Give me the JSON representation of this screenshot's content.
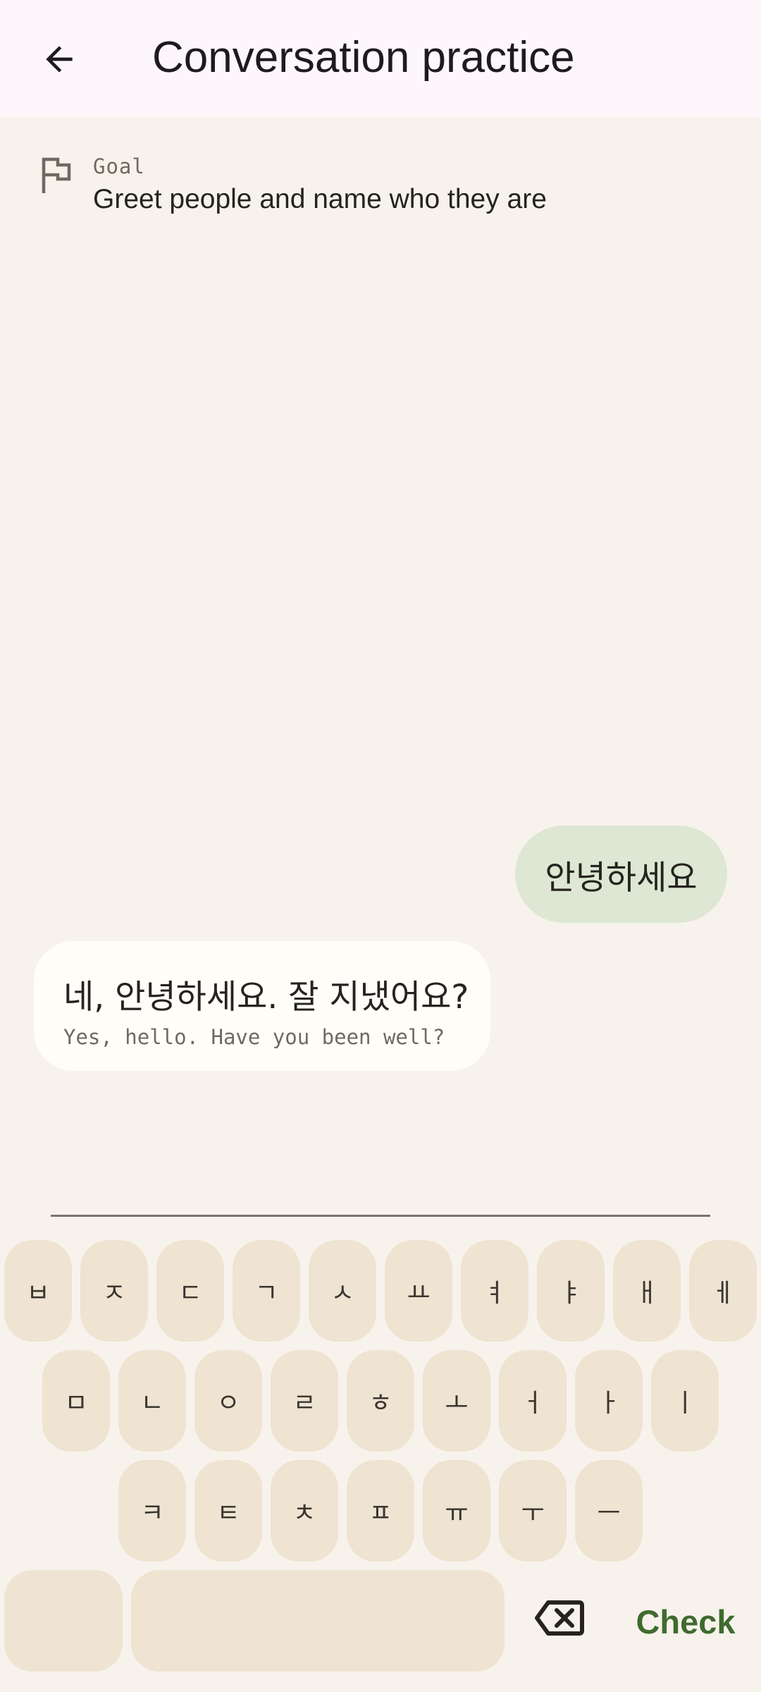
{
  "header": {
    "title": "Conversation practice",
    "back_icon": "arrow-left-icon"
  },
  "goal": {
    "icon": "flag-icon",
    "label": "Goal",
    "text": "Greet people and name who they are"
  },
  "messages": [
    {
      "role": "user",
      "text": "안녕하세요"
    },
    {
      "role": "partner",
      "text": "네, 안녕하세요. 잘 지냈어요?",
      "translation": "Yes, hello. Have you been well?"
    }
  ],
  "keyboard": {
    "rows": [
      [
        "ㅂ",
        "ㅈ",
        "ㄷ",
        "ㄱ",
        "ㅅ",
        "ㅛ",
        "ㅕ",
        "ㅑ",
        "ㅐ",
        "ㅔ"
      ],
      [
        "ㅁ",
        "ㄴ",
        "ㅇ",
        "ㄹ",
        "ㅎ",
        "ㅗ",
        "ㅓ",
        "ㅏ",
        "ㅣ"
      ],
      [
        "ㅋ",
        "ㅌ",
        "ㅊ",
        "ㅍ",
        "ㅠ",
        "ㅜ",
        "ㅡ"
      ]
    ],
    "backspace_icon": "backspace-icon",
    "check_label": "Check"
  },
  "colors": {
    "background": "#f7f3ec",
    "app_bar": "#fdf7fc",
    "user_bubble": "#dde7d3",
    "partner_bubble": "#fffdf8",
    "key": "#efe3d1",
    "accent": "#3f6b2f"
  }
}
